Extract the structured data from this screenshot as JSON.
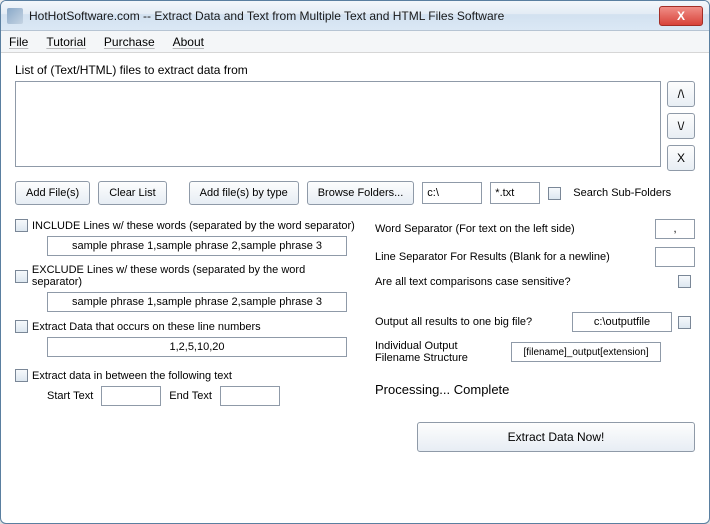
{
  "window": {
    "title": "HotHotSoftware.com -- Extract Data and Text from Multiple Text and HTML Files Software",
    "close_glyph": "X"
  },
  "menu": {
    "file": "File",
    "tutorial": "Tutorial",
    "purchase": "Purchase",
    "about": "About"
  },
  "list_label": "List of (Text/HTML) files to extract data from",
  "side": {
    "up": "/\\",
    "down": "\\/",
    "remove": "X"
  },
  "toolbar": {
    "add_files": "Add File(s)",
    "clear_list": "Clear List",
    "add_by_type": "Add file(s) by type",
    "browse_folders": "Browse Folders...",
    "path_value": "c:\\",
    "ext_value": "*.txt",
    "search_sub": "Search Sub-Folders"
  },
  "left": {
    "include_label": "INCLUDE Lines w/ these words (separated by the word separator)",
    "include_value": "sample phrase 1,sample phrase 2,sample phrase 3",
    "exclude_label": "EXCLUDE Lines w/ these words (separated by the word separator)",
    "exclude_value": "sample phrase 1,sample phrase 2,sample phrase 3",
    "linenums_label": "Extract Data that occurs on these line numbers",
    "linenums_value": "1,2,5,10,20",
    "between_label": "Extract data in between the following text",
    "start_text_label": "Start Text",
    "end_text_label": "End Text"
  },
  "right": {
    "word_sep_label": "Word Separator (For text on the left side)",
    "word_sep_value": ",",
    "line_sep_label": "Line Separator For Results (Blank for a newline)",
    "case_label": "Are all text comparisons case sensitive?",
    "output_one_label": "Output all results to one big file?",
    "output_one_value": "c:\\outputfile",
    "filename_struct_label": "Individual Output Filename Structure",
    "filename_struct_value": "[filename]_output[extension]",
    "status": "Processing... Complete"
  },
  "extract_btn": "Extract Data Now!"
}
